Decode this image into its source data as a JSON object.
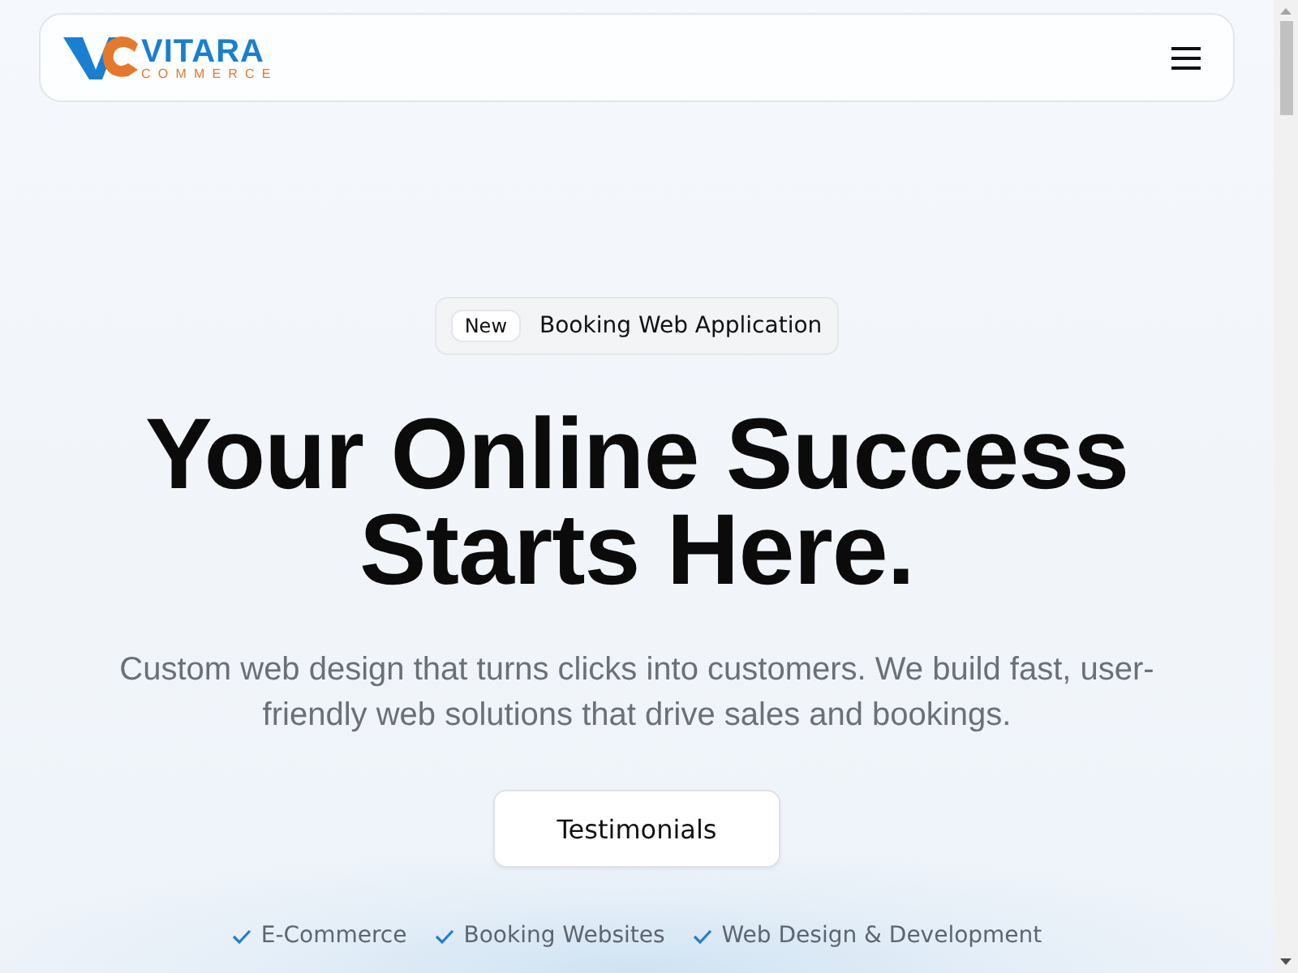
{
  "header": {
    "logo": {
      "name": "VITARA",
      "tagline": "COMMERCE"
    }
  },
  "hero": {
    "badge": {
      "tag": "New",
      "text": "Booking Web Application"
    },
    "title_lines": [
      "Your Online Success",
      "Starts Here."
    ],
    "subtitle": "Custom web design that turns clicks into customers. We build fast, user-friendly web solutions that drive sales and bookings.",
    "button": "Testimonials",
    "features": [
      "E-Commerce",
      "Booking Websites",
      "Web Design & Development"
    ]
  }
}
